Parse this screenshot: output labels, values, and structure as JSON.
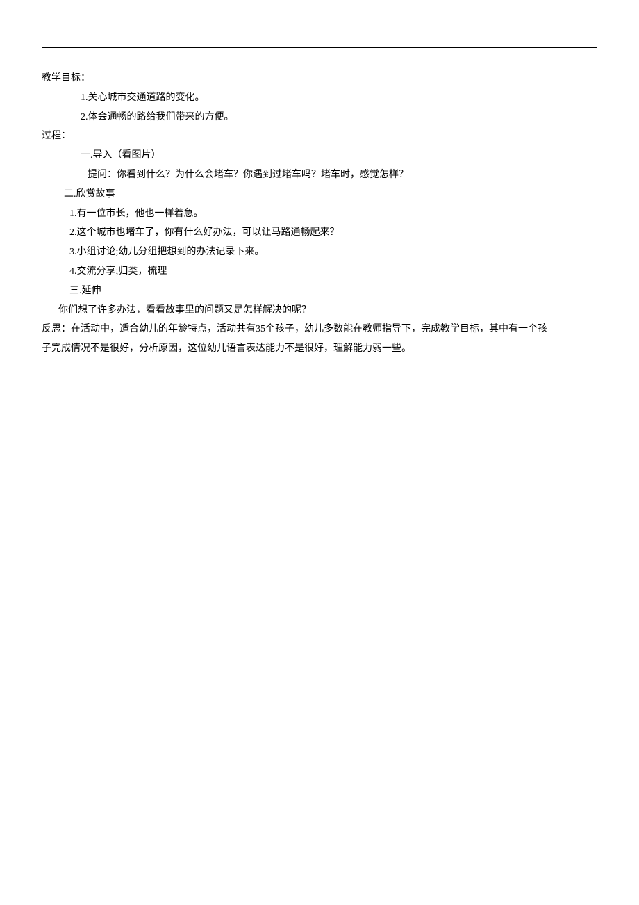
{
  "section1": {
    "title": "教学目标：",
    "items": [
      "1.关心城市交通道路的变化。",
      "2.体会通畅的路给我们带来的方便。"
    ]
  },
  "section2": {
    "title": "过程：",
    "part1": {
      "heading": "一.导入（看图片）",
      "question": "提问：你看到什么？为什么会堵车？你遇到过堵车吗？堵车时，感觉怎样？"
    },
    "part2": {
      "heading": "二.欣赏故事",
      "items": [
        "1.有一位市长，他也一样着急。",
        "2.这个城市也堵车了，你有什么好办法，可以让马路通畅起来？",
        "3.小组讨论;幼儿分组把想到的办法记录下来。",
        "4.交流分享;归类，梳理"
      ]
    },
    "part3": {
      "heading": "三.延伸",
      "text": "你们想了许多办法，看看故事里的问题又是怎样解决的呢？"
    }
  },
  "reflection": {
    "line1": "反思：在活动中，适合幼儿的年龄特点，活动共有35个孩子，幼儿多数能在教师指导下，完成教学目标，其中有一个孩",
    "line2": "子完成情况不是很好，分析原因，这位幼儿语言表达能力不是很好，理解能力弱一些。"
  }
}
